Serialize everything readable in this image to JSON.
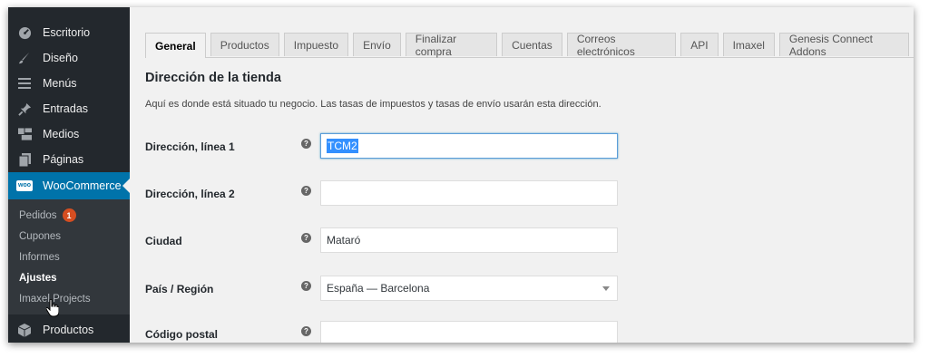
{
  "sidebar": {
    "items": [
      {
        "label": "Escritorio",
        "icon": "dashboard-icon"
      },
      {
        "label": "Diseño",
        "icon": "brush-icon"
      },
      {
        "label": "Menús",
        "icon": "menu-icon"
      },
      {
        "label": "Entradas",
        "icon": "pin-icon"
      },
      {
        "label": "Medios",
        "icon": "media-icon"
      },
      {
        "label": "Páginas",
        "icon": "pages-icon"
      },
      {
        "label": "WooCommerce",
        "icon": "woo-icon"
      }
    ],
    "woo_icon_text": "woo",
    "submenu": [
      {
        "label": "Pedidos",
        "badge": "1"
      },
      {
        "label": "Cupones"
      },
      {
        "label": "Informes"
      },
      {
        "label": "Ajustes"
      },
      {
        "label": "Imaxel Projects"
      }
    ],
    "after": {
      "label": "Productos",
      "icon": "product-icon"
    }
  },
  "tabs": [
    "General",
    "Productos",
    "Impuesto",
    "Envío",
    "Finalizar compra",
    "Cuentas",
    "Correos electrónicos",
    "API",
    "Imaxel",
    "Genesis Connect Addons"
  ],
  "active_tab": "General",
  "section": {
    "title": "Dirección de la tienda",
    "description": "Aquí es donde está situado tu negocio. Las tasas de impuestos y tasas de envío usarán esta dirección."
  },
  "fields": [
    {
      "label": "Dirección, línea 1",
      "value": "TCM2"
    },
    {
      "label": "Dirección, línea 2",
      "value": ""
    },
    {
      "label": "Ciudad",
      "value": "Mataró"
    },
    {
      "label": "País / Región",
      "value": "España — Barcelona"
    },
    {
      "label": "Código postal",
      "value": ""
    }
  ],
  "help_glyph": "?",
  "colors": {
    "sidebar": "#23282d",
    "submenu": "#32373c",
    "accent": "#0073aa",
    "badge": "#d54e21"
  }
}
